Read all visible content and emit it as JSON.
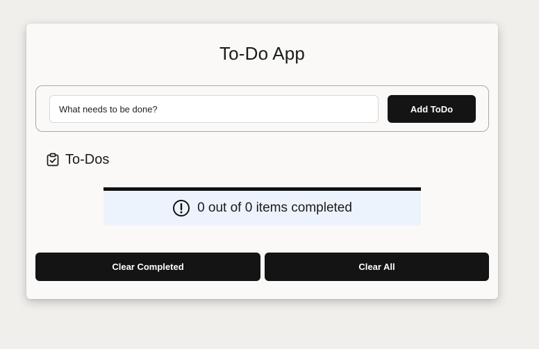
{
  "app": {
    "title": "To-Do App"
  },
  "input": {
    "placeholder": "What needs to be done?",
    "value": ""
  },
  "buttons": {
    "add_label": "Add ToDo",
    "clear_completed_label": "Clear Completed",
    "clear_all_label": "Clear All"
  },
  "list": {
    "title": "To-Dos",
    "icon": "clipboard-check-icon",
    "items": []
  },
  "status": {
    "icon": "exclamation-circle-icon",
    "text": "0 out of 0 items completed"
  },
  "colors": {
    "background": "#f0efec",
    "card": "#faf9f7",
    "button": "#141414",
    "status_background": "#edf3fc"
  }
}
